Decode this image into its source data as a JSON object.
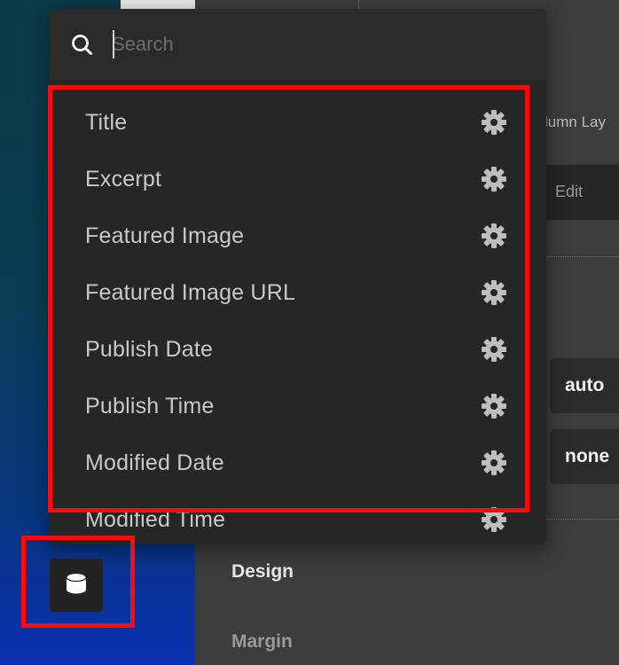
{
  "search": {
    "placeholder": "Search",
    "value": ""
  },
  "dropdown": {
    "items": [
      {
        "label": "Title",
        "icon": "gear-icon"
      },
      {
        "label": "Excerpt",
        "icon": "gear-icon"
      },
      {
        "label": "Featured Image",
        "icon": "gear-icon"
      },
      {
        "label": "Featured Image URL",
        "icon": "gear-icon"
      },
      {
        "label": "Publish Date",
        "icon": "gear-icon"
      },
      {
        "label": "Publish Time",
        "icon": "gear-icon"
      },
      {
        "label": "Modified Date",
        "icon": "gear-icon"
      },
      {
        "label": "Modified Time",
        "icon": "gear-icon"
      }
    ]
  },
  "panel": {
    "column_layout_label": "lumn Lay",
    "edit_label": "Edit",
    "value_auto": "auto",
    "value_none": "none",
    "design_label": "Design",
    "margin_label": "Margin"
  },
  "dynamic_data_button": {
    "icon": "database-icon"
  },
  "colors": {
    "highlight": "#ff0a0a",
    "dropdown_bg": "#262626",
    "item_text": "#c9c9c9",
    "panel_bg": "#3c3c3c"
  }
}
